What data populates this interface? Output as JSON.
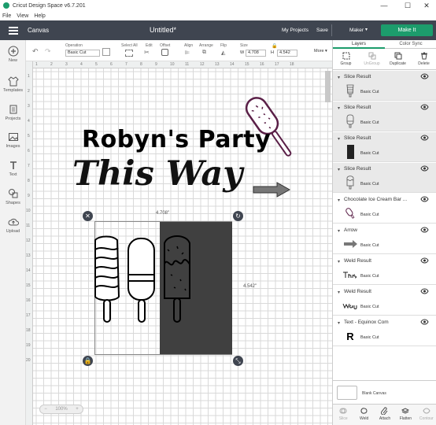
{
  "window": {
    "title": "Cricut Design Space  v6.7.201",
    "controls": [
      "—",
      "☐",
      "✕"
    ]
  },
  "menu": [
    "File",
    "View",
    "Help"
  ],
  "header": {
    "section": "Canvas",
    "doc_title": "Untitled*",
    "my_projects": "My Projects",
    "save": "Save",
    "machine": "Maker",
    "make_it": "Make It"
  },
  "left_nav": [
    {
      "label": "New",
      "icon": "plus-icon"
    },
    {
      "label": "Templates",
      "icon": "shirt-icon"
    },
    {
      "label": "Projects",
      "icon": "folder-icon"
    },
    {
      "label": "Images",
      "icon": "image-icon"
    },
    {
      "label": "Text",
      "icon": "text-icon"
    },
    {
      "label": "Shapes",
      "icon": "shapes-icon"
    },
    {
      "label": "Upload",
      "icon": "upload-icon"
    }
  ],
  "toolbar": {
    "operation_label": "Operation",
    "operation_value": "Basic Cut",
    "select_all": "Select All",
    "edit": "Edit",
    "offset": "Offset",
    "align": "Align",
    "arrange": "Arrange",
    "flip": "Flip",
    "size": "Size",
    "w_label": "W",
    "w_value": "4.708",
    "h_label": "H",
    "h_value": "4.542",
    "more": "More ▾"
  },
  "canvas": {
    "title_text": "Robyn's Party",
    "script_text": "This Way",
    "width_label": "4.708\"",
    "height_label": "4.542\"",
    "zoom": "100%",
    "zoom_minus": "−",
    "zoom_plus": "+",
    "ruler_top": [
      "1",
      "2",
      "3",
      "4",
      "5",
      "6",
      "7",
      "8",
      "9",
      "10",
      "11",
      "12",
      "13",
      "14",
      "15",
      "16",
      "17",
      "18"
    ],
    "ruler_left": [
      "1",
      "2",
      "3",
      "4",
      "5",
      "6",
      "7",
      "8",
      "9",
      "10",
      "11",
      "12",
      "13",
      "14",
      "15",
      "16",
      "17",
      "18",
      "19",
      "20"
    ]
  },
  "panel": {
    "tabs": [
      "Layers",
      "Color Sync"
    ],
    "tools": [
      {
        "label": "Group",
        "enabled": true
      },
      {
        "label": "UnGroup",
        "enabled": false
      },
      {
        "label": "Duplicate",
        "enabled": true
      },
      {
        "label": "Delete",
        "enabled": true
      }
    ],
    "layers": [
      {
        "name": "Slice Result",
        "cut": "Basic Cut",
        "thumb": "popsicle-swirl",
        "selected": true
      },
      {
        "name": "Slice Result",
        "cut": "Basic Cut",
        "thumb": "popsicle-plain",
        "selected": true
      },
      {
        "name": "Slice Result",
        "cut": "Basic Cut",
        "thumb": "dark-rect",
        "selected": true
      },
      {
        "name": "Slice Result",
        "cut": "Basic Cut",
        "thumb": "popsicle-drip",
        "selected": true
      },
      {
        "name": "Chocolate Ice Cream Bar ...",
        "cut": "Basic Cut",
        "thumb": "popsicle-pink",
        "selected": false
      },
      {
        "name": "Arrow",
        "cut": "Basic Cut",
        "thumb": "arrow",
        "selected": false
      },
      {
        "name": "Weld Result",
        "cut": "Basic Cut",
        "thumb": "script-this",
        "selected": false
      },
      {
        "name": "Weld Result",
        "cut": "Basic Cut",
        "thumb": "script-way",
        "selected": false
      },
      {
        "name": "Text - Equinox Com",
        "cut": "Basic Cut",
        "thumb": "letter-r",
        "selected": false
      }
    ],
    "thumb_letter": "R",
    "blank_canvas": "Blank Canvas",
    "bottom_tools": [
      {
        "label": "Slice",
        "enabled": false
      },
      {
        "label": "Weld",
        "enabled": true
      },
      {
        "label": "Attach",
        "enabled": true
      },
      {
        "label": "Flatten",
        "enabled": true
      },
      {
        "label": "Contour",
        "enabled": false
      }
    ]
  },
  "colors": {
    "topbar": "#3f4550",
    "accent": "#1c9c6c",
    "selected_layer": "#e9e9e9",
    "popsicle_outline": "#5a1f47"
  }
}
